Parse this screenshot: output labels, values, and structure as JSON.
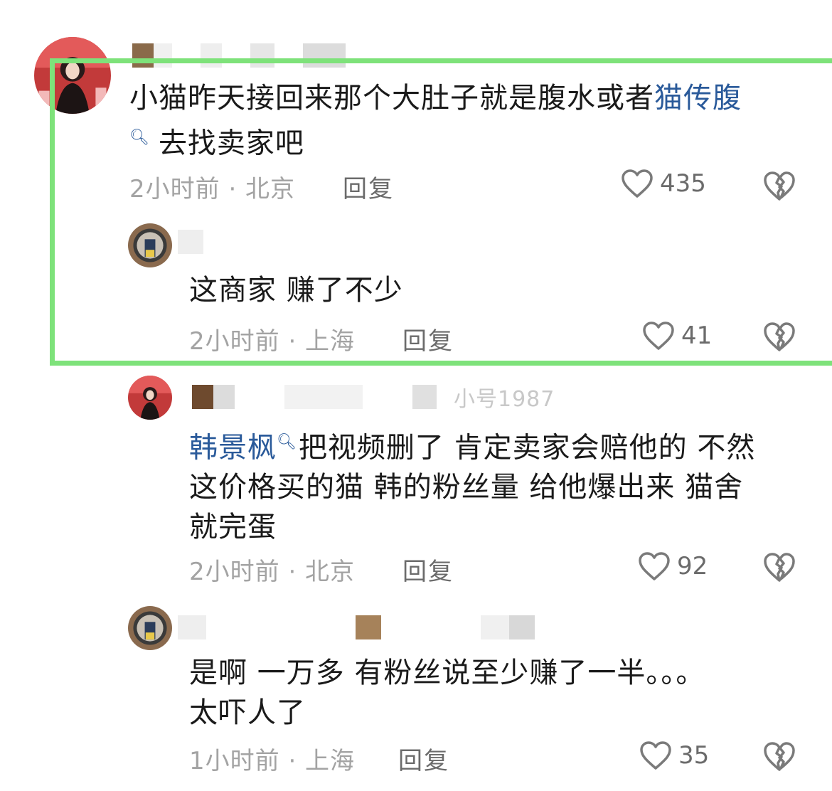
{
  "comments": [
    {
      "username": "",
      "text_plain_1": "小猫昨天接回来那个大肚子就是腹水或者",
      "link_1": "猫传腹",
      "text_plain_2": "去找卖家吧",
      "time_location": "2小时前 · 北京",
      "reply_label": "回复",
      "likes": "435"
    },
    {
      "username": "",
      "text": "这商家  赚了不少",
      "time_location": "2小时前 · 上海",
      "reply_label": "回复",
      "likes": "41"
    },
    {
      "username_visible": "小号1987",
      "link": "韩景枫",
      "text_line1": "把视频删了 肯定卖家会赔他的 不然",
      "text_line2": "这价格买的猫 韩的粉丝量 给他爆出来 猫舍",
      "text_line3": "就完蛋",
      "time_location": "2小时前 · 北京",
      "reply_label": "回复",
      "likes": "92"
    },
    {
      "username": "",
      "text_line1": "是啊  一万多  有粉丝说至少赚了一半。。。",
      "text_line2": "太吓人了",
      "time_location": "1小时前 · 上海",
      "reply_label": "回复",
      "likes": "35"
    }
  ],
  "colors": {
    "highlight": "#7ee27a",
    "link": "#2a5a9a",
    "meta": "#a3a3a3"
  }
}
